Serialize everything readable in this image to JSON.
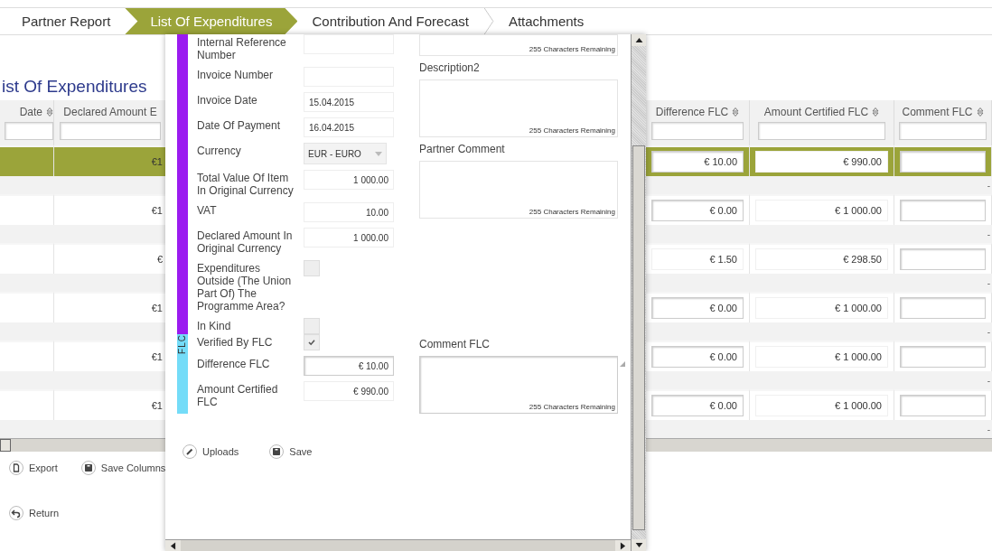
{
  "tabs": [
    {
      "label": "Partner Report",
      "selected": false
    },
    {
      "label": "List Of Expenditures",
      "selected": true
    },
    {
      "label": "Contribution And Forecast",
      "selected": false
    },
    {
      "label": "Attachments",
      "selected": false
    }
  ],
  "page_title": "ist Of Expenditures",
  "table": {
    "columns": [
      "Date",
      "Declared Amount E",
      "Difference FLC",
      "Amount Certified FLC",
      "Comment FLC"
    ],
    "rows": [
      {
        "selected": true,
        "declared": "€1",
        "difference": "€ 10.00",
        "difference_editable": true,
        "certified": "€ 990.00",
        "detail_mark": "-"
      },
      {
        "selected": false,
        "declared": "€1",
        "difference": "€ 0.00",
        "difference_editable": true,
        "certified": "€ 1 000.00",
        "detail_mark": "-"
      },
      {
        "selected": false,
        "declared": "€",
        "difference": "€ 1.50",
        "difference_editable": false,
        "certified": "€ 298.50",
        "detail_mark": "-"
      },
      {
        "selected": false,
        "declared": "€1",
        "difference": "€ 0.00",
        "difference_editable": true,
        "certified": "€ 1 000.00",
        "detail_mark": "-"
      },
      {
        "selected": false,
        "declared": "€1",
        "difference": "€ 0.00",
        "difference_editable": true,
        "certified": "€ 1 000.00",
        "detail_mark": "-"
      },
      {
        "selected": false,
        "declared": "€1",
        "difference": "€ 0.00",
        "difference_editable": true,
        "certified": "€ 1 000.00",
        "detail_mark": "-"
      }
    ]
  },
  "table_buttons": [
    {
      "label": "Export",
      "kind": "export"
    },
    {
      "label": "Save Columns",
      "kind": "save"
    }
  ],
  "return_button": "Return",
  "dialog": {
    "fields": [
      {
        "kind": "text",
        "label": "Internal Reference Number"
      },
      {
        "kind": "text",
        "label": "Invoice Number"
      },
      {
        "kind": "text",
        "label": "Invoice Date",
        "value": "15.04.2015"
      },
      {
        "kind": "text",
        "label": "Date Of Payment",
        "value": "16.04.2015"
      },
      {
        "kind": "select",
        "label": "Currency",
        "value": "EUR - EURO"
      },
      {
        "kind": "number",
        "label": "Total Value Of Item In Original Currency",
        "value": "1 000.00"
      },
      {
        "kind": "number",
        "label": "VAT",
        "value": "10.00"
      },
      {
        "kind": "number",
        "label": "Declared Amount In Original Currency",
        "value": "1 000.00"
      },
      {
        "kind": "checkbox",
        "label": "Expenditures Outside (The Union Part Of) The Programme Area?",
        "checked": false
      },
      {
        "kind": "checkbox",
        "label": "In Kind",
        "checked": false
      }
    ],
    "text_areas": [
      {
        "counter": "255 Characters Remaining"
      },
      {
        "label": "Description2",
        "counter": "255 Characters Remaining"
      },
      {
        "label": "Partner Comment",
        "counter": "255 Characters Remaining"
      }
    ],
    "flc_label": "FLC",
    "flc_fields": [
      {
        "kind": "checkbox",
        "label": "Verified By FLC",
        "checked": true
      },
      {
        "kind": "number",
        "label": "Difference FLC",
        "value": "€ 10.00"
      },
      {
        "kind": "number",
        "label": "Amount Certified FLC",
        "value": "€ 990.00"
      }
    ],
    "flc_text_area": {
      "label": "Comment FLC",
      "counter": "255 Characters Remaining"
    },
    "buttons": [
      {
        "label": "Uploads",
        "kind": "upload"
      },
      {
        "label": "Save",
        "kind": "save"
      }
    ]
  }
}
